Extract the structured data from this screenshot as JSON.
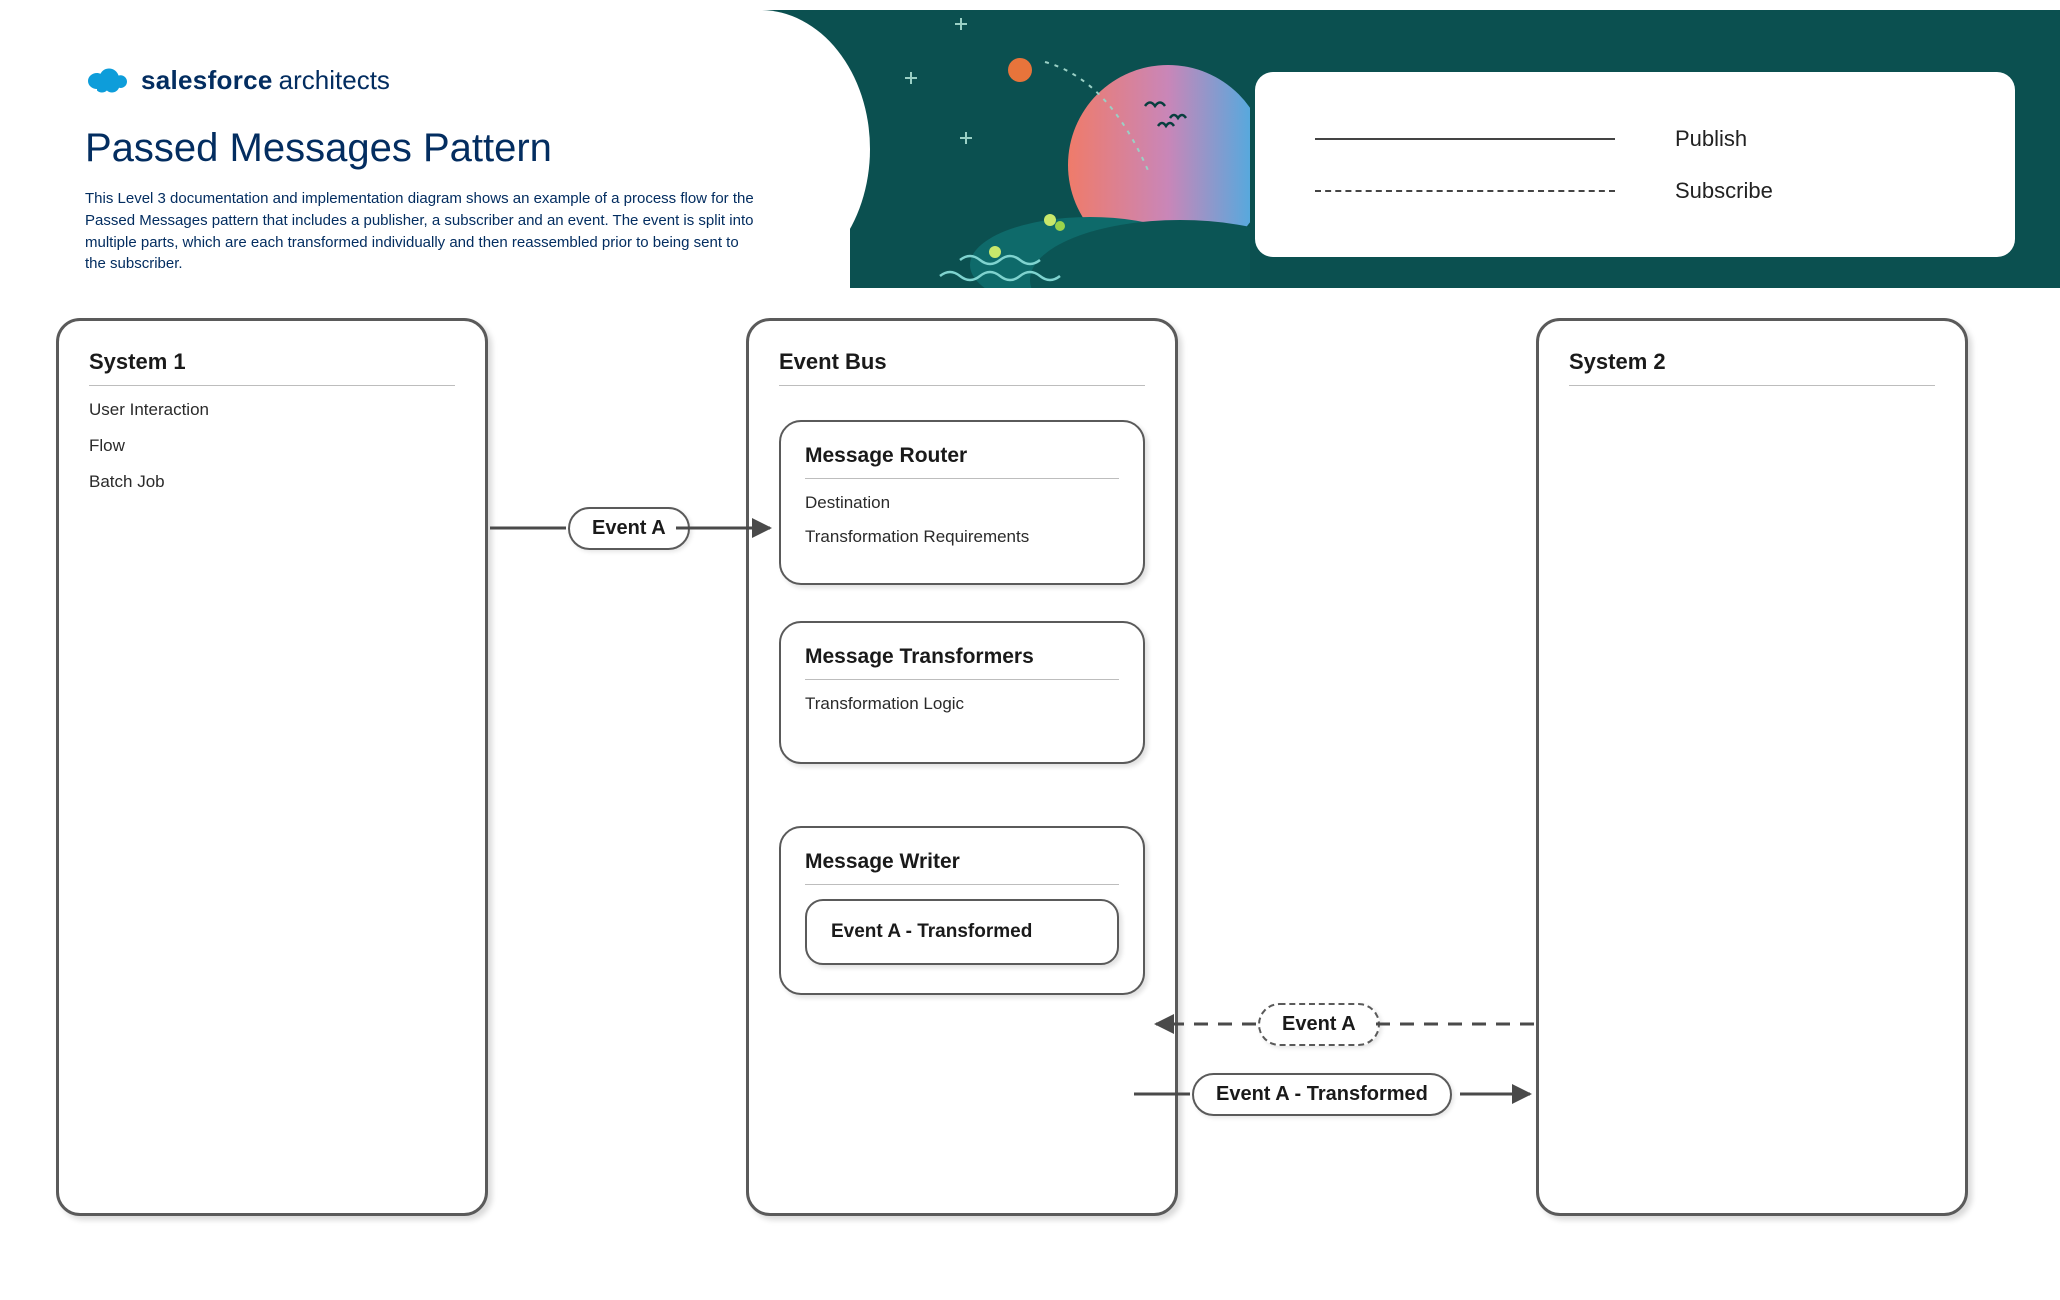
{
  "brand": {
    "name": "salesforce",
    "suffix": "architects"
  },
  "title": "Passed Messages Pattern",
  "description": "This Level 3 documentation and implementation diagram shows an example of a process flow for the Passed Messages pattern that includes a publisher, a subscriber and an event.  The event is split into multiple parts, which are each transformed individually and then reassembled prior to being sent to the subscriber.",
  "legend": {
    "publish": "Publish",
    "subscribe": "Subscribe"
  },
  "system1": {
    "title": "System 1",
    "items": [
      "User Interaction",
      "Flow",
      "Batch Job"
    ]
  },
  "eventBus": {
    "title": "Event Bus",
    "router": {
      "title": "Message Router",
      "items": [
        "Destination",
        "Transformation Requirements"
      ]
    },
    "transformers": {
      "title": "Message Transformers",
      "items": [
        "Transformation Logic"
      ]
    },
    "writer": {
      "title": "Message Writer",
      "inner": "Event A - Transformed"
    }
  },
  "system2": {
    "title": "System 2"
  },
  "labels": {
    "eventA": "Event A",
    "subEventA": "Event A",
    "transformed": "Event A - Transformed"
  }
}
